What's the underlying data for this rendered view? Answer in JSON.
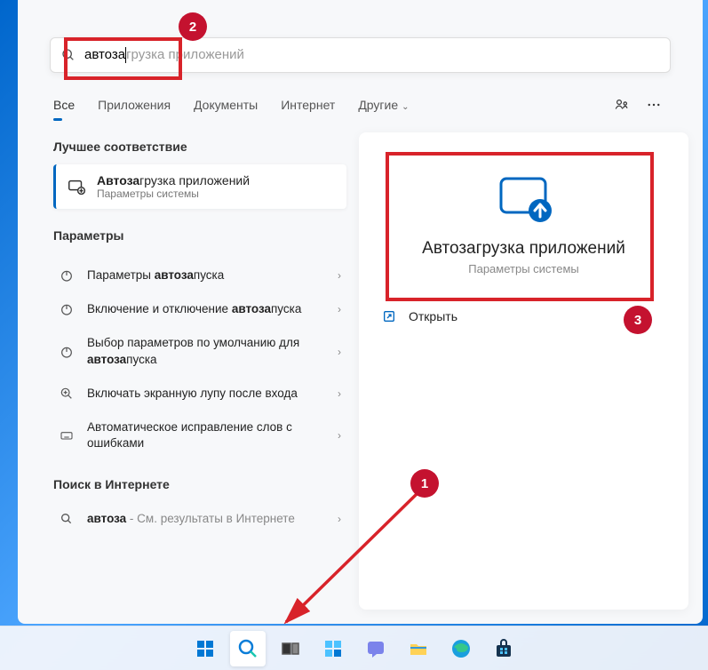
{
  "search": {
    "typed": "автоза",
    "suggestion_rest": "грузка приложений"
  },
  "tabs": {
    "items": [
      "Все",
      "Приложения",
      "Документы",
      "Интернет",
      "Другие"
    ],
    "active_index": 0
  },
  "left": {
    "best_match_label": "Лучшее соответствие",
    "best_match": {
      "title_bold": "Автоза",
      "title_rest": "грузка приложений",
      "subtitle": "Параметры системы"
    },
    "settings_label": "Параметры",
    "settings": [
      {
        "icon": "power-icon",
        "pre": "Параметры ",
        "bold": "автоза",
        "post": "пуска"
      },
      {
        "icon": "power-icon",
        "pre": "Включение и отключение ",
        "bold": "автоза",
        "post": "пуска"
      },
      {
        "icon": "power-icon",
        "pre": "Выбор параметров по умолчанию для ",
        "bold": "автоза",
        "post": "пуска"
      },
      {
        "icon": "magnifier-plus-icon",
        "pre": "Включать экранную лупу после входа",
        "bold": "",
        "post": ""
      },
      {
        "icon": "keyboard-icon",
        "pre": "Автоматическое исправление слов с ошибками",
        "bold": "",
        "post": ""
      }
    ],
    "web_label": "Поиск в Интернете",
    "web": {
      "query": "автоза",
      "suffix": " - См. результаты в Интернете"
    }
  },
  "right": {
    "preview_title": "Автозагрузка приложений",
    "preview_sub": "Параметры системы",
    "open_label": "Открыть"
  },
  "annotations": {
    "badge1": "1",
    "badge2": "2",
    "badge3": "3"
  },
  "taskbar_icons": [
    "start",
    "search",
    "taskview",
    "widgets",
    "chat",
    "explorer",
    "edge",
    "store"
  ]
}
